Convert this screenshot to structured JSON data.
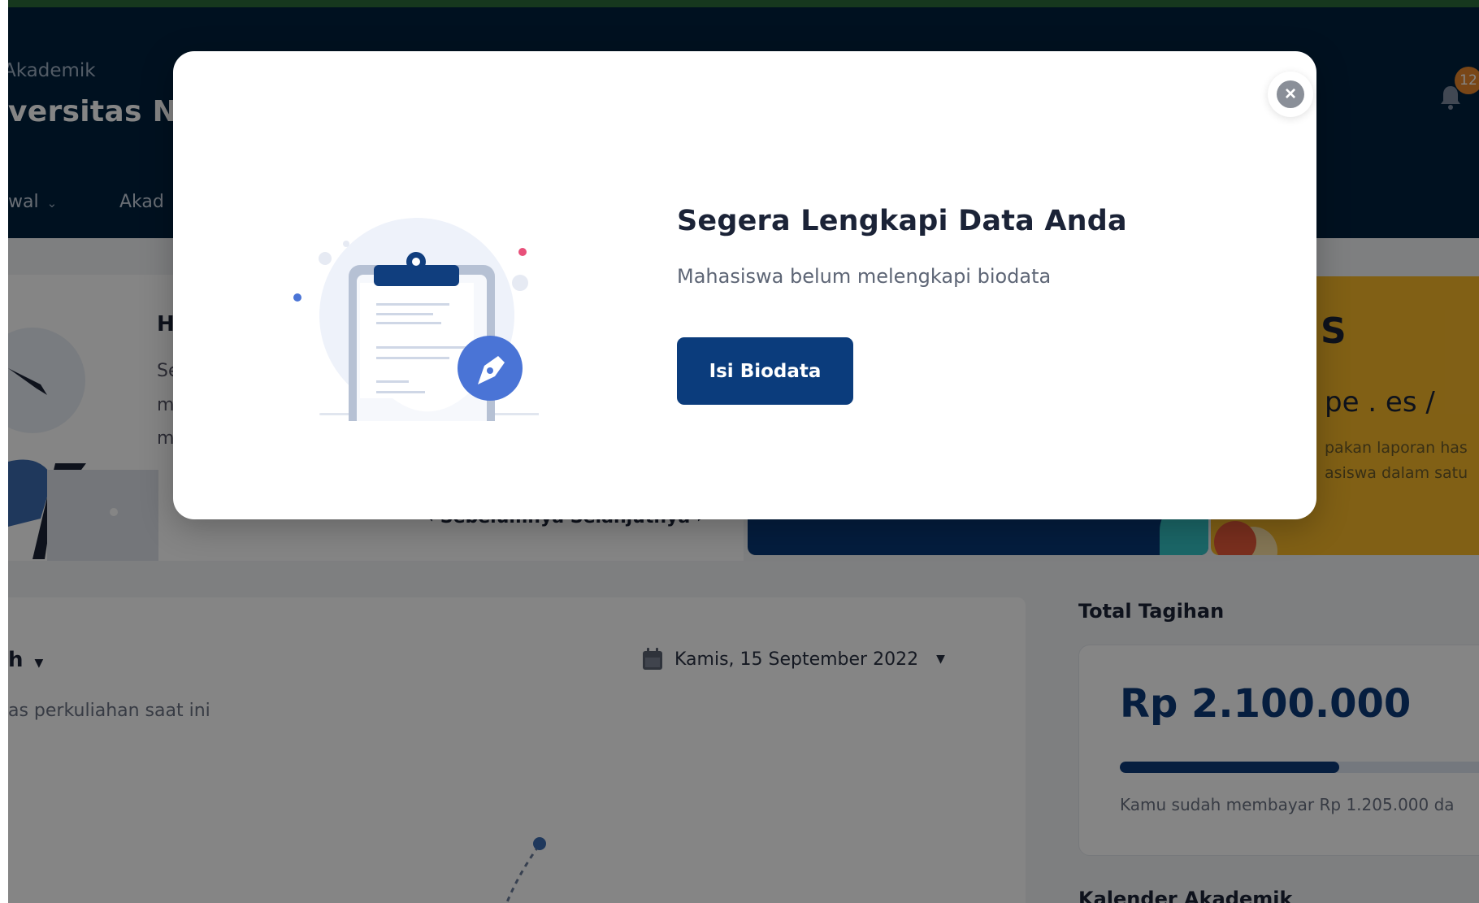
{
  "app": {
    "brand_subtitle": "Akademik",
    "brand_title": "versitas Na",
    "nav": [
      {
        "label": "wal"
      },
      {
        "label": "Akad"
      }
    ],
    "notification_count": "12"
  },
  "hero": {
    "heading": "H",
    "lines": [
      "Se",
      "m",
      "m"
    ],
    "pager": "‹ Sebelumnya   Selanjutnya ›"
  },
  "promo": {
    "title": "S",
    "subtitle": "pe . es /",
    "lines": [
      "pakan laporan has",
      "asiswa dalam satu"
    ]
  },
  "schedule": {
    "title": "h",
    "subtitle": "as perkuliahan saat ini",
    "date": "Kamis, 15 September 2022"
  },
  "billing": {
    "label": "Total Tagihan",
    "amount": "Rp 2.100.000",
    "paid_fraction": 0.574,
    "note": "Kamu sudah membayar Rp 1.205.000 da",
    "calendar_label": "Kalender Akademik"
  },
  "modal": {
    "title": "Segera Lengkapi Data Anda",
    "subtitle": "Mahasiswa belum melengkapi biodata",
    "button_label": "Isi Biodata",
    "close_icon": "close-icon",
    "illustration_icon": "clipboard-pen-icon"
  },
  "colors": {
    "header": "#00223f",
    "primary": "#0b3c7c",
    "accent_orange": "#f7b92a",
    "badge": "#e8872d"
  }
}
